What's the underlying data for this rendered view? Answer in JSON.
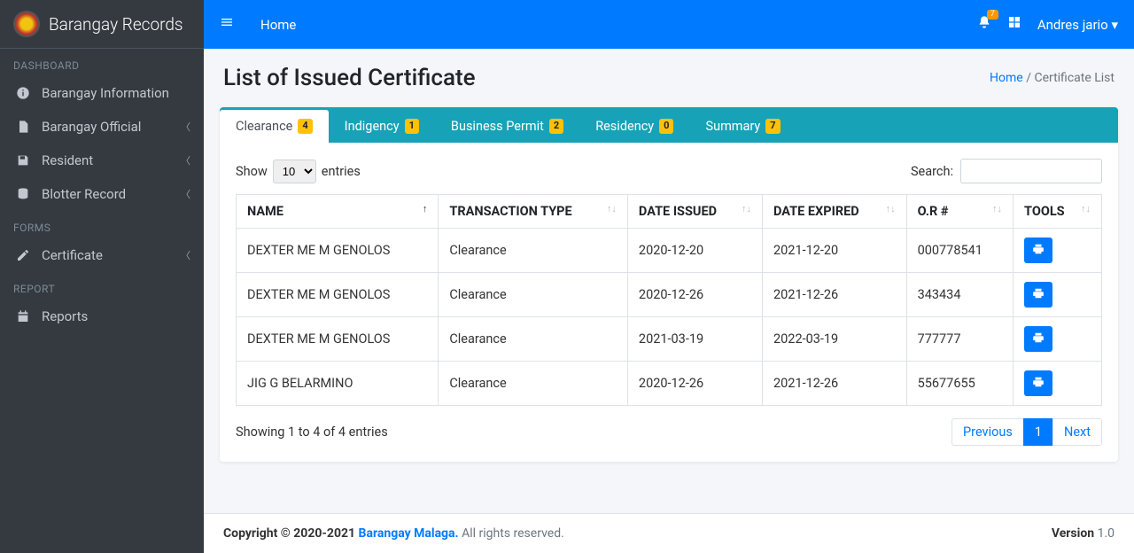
{
  "brand": "Barangay Records",
  "sidebar": {
    "sections": [
      {
        "header": "DASHBOARD",
        "items": [
          {
            "label": "Barangay Information",
            "icon": "info",
            "expandable": false
          },
          {
            "label": "Barangay Official",
            "icon": "file",
            "expandable": true
          },
          {
            "label": "Resident",
            "icon": "save",
            "expandable": true
          },
          {
            "label": "Blotter Record",
            "icon": "db",
            "expandable": true
          }
        ]
      },
      {
        "header": "FORMS",
        "items": [
          {
            "label": "Certificate",
            "icon": "edit",
            "expandable": true
          }
        ]
      },
      {
        "header": "REPORT",
        "items": [
          {
            "label": "Reports",
            "icon": "cal",
            "expandable": false
          }
        ]
      }
    ]
  },
  "topbar": {
    "crumb": "Home",
    "notif_count": "7",
    "user": "Andres jario"
  },
  "page": {
    "title": "List of Issued Certificate",
    "breadcrumb_home": "Home",
    "breadcrumb_current": "Certificate List"
  },
  "tabs": [
    {
      "label": "Clearance",
      "badge": "4",
      "active": true
    },
    {
      "label": "Indigency",
      "badge": "1"
    },
    {
      "label": "Business Permit",
      "badge": "2"
    },
    {
      "label": "Residency",
      "badge": "0"
    },
    {
      "label": "Summary",
      "badge": "7"
    }
  ],
  "table": {
    "length_prefix": "Show",
    "length_value": "10",
    "length_suffix": "entries",
    "search_label": "Search:",
    "columns": [
      "NAME",
      "TRANSACTION TYPE",
      "DATE ISSUED",
      "DATE EXPIRED",
      "O.R #",
      "TOOLS"
    ],
    "rows": [
      {
        "name": "DEXTER ME M GENOLOS",
        "type": "Clearance",
        "issued": "2020-12-20",
        "expired": "2021-12-20",
        "or": "000778541"
      },
      {
        "name": "DEXTER ME M GENOLOS",
        "type": "Clearance",
        "issued": "2020-12-26",
        "expired": "2021-12-26",
        "or": "343434"
      },
      {
        "name": "DEXTER ME M GENOLOS",
        "type": "Clearance",
        "issued": "2021-03-19",
        "expired": "2022-03-19",
        "or": "777777"
      },
      {
        "name": "JIG G BELARMINO",
        "type": "Clearance",
        "issued": "2020-12-26",
        "expired": "2021-12-26",
        "or": "55677655"
      }
    ],
    "info": "Showing 1 to 4 of 4 entries",
    "prev": "Previous",
    "page": "1",
    "next": "Next"
  },
  "footer": {
    "copyright_prefix": "Copyright © 2020-2021 ",
    "brand": "Barangay Malaga.",
    "rights": " All rights reserved.",
    "version_label": "Version ",
    "version": "1.0"
  }
}
